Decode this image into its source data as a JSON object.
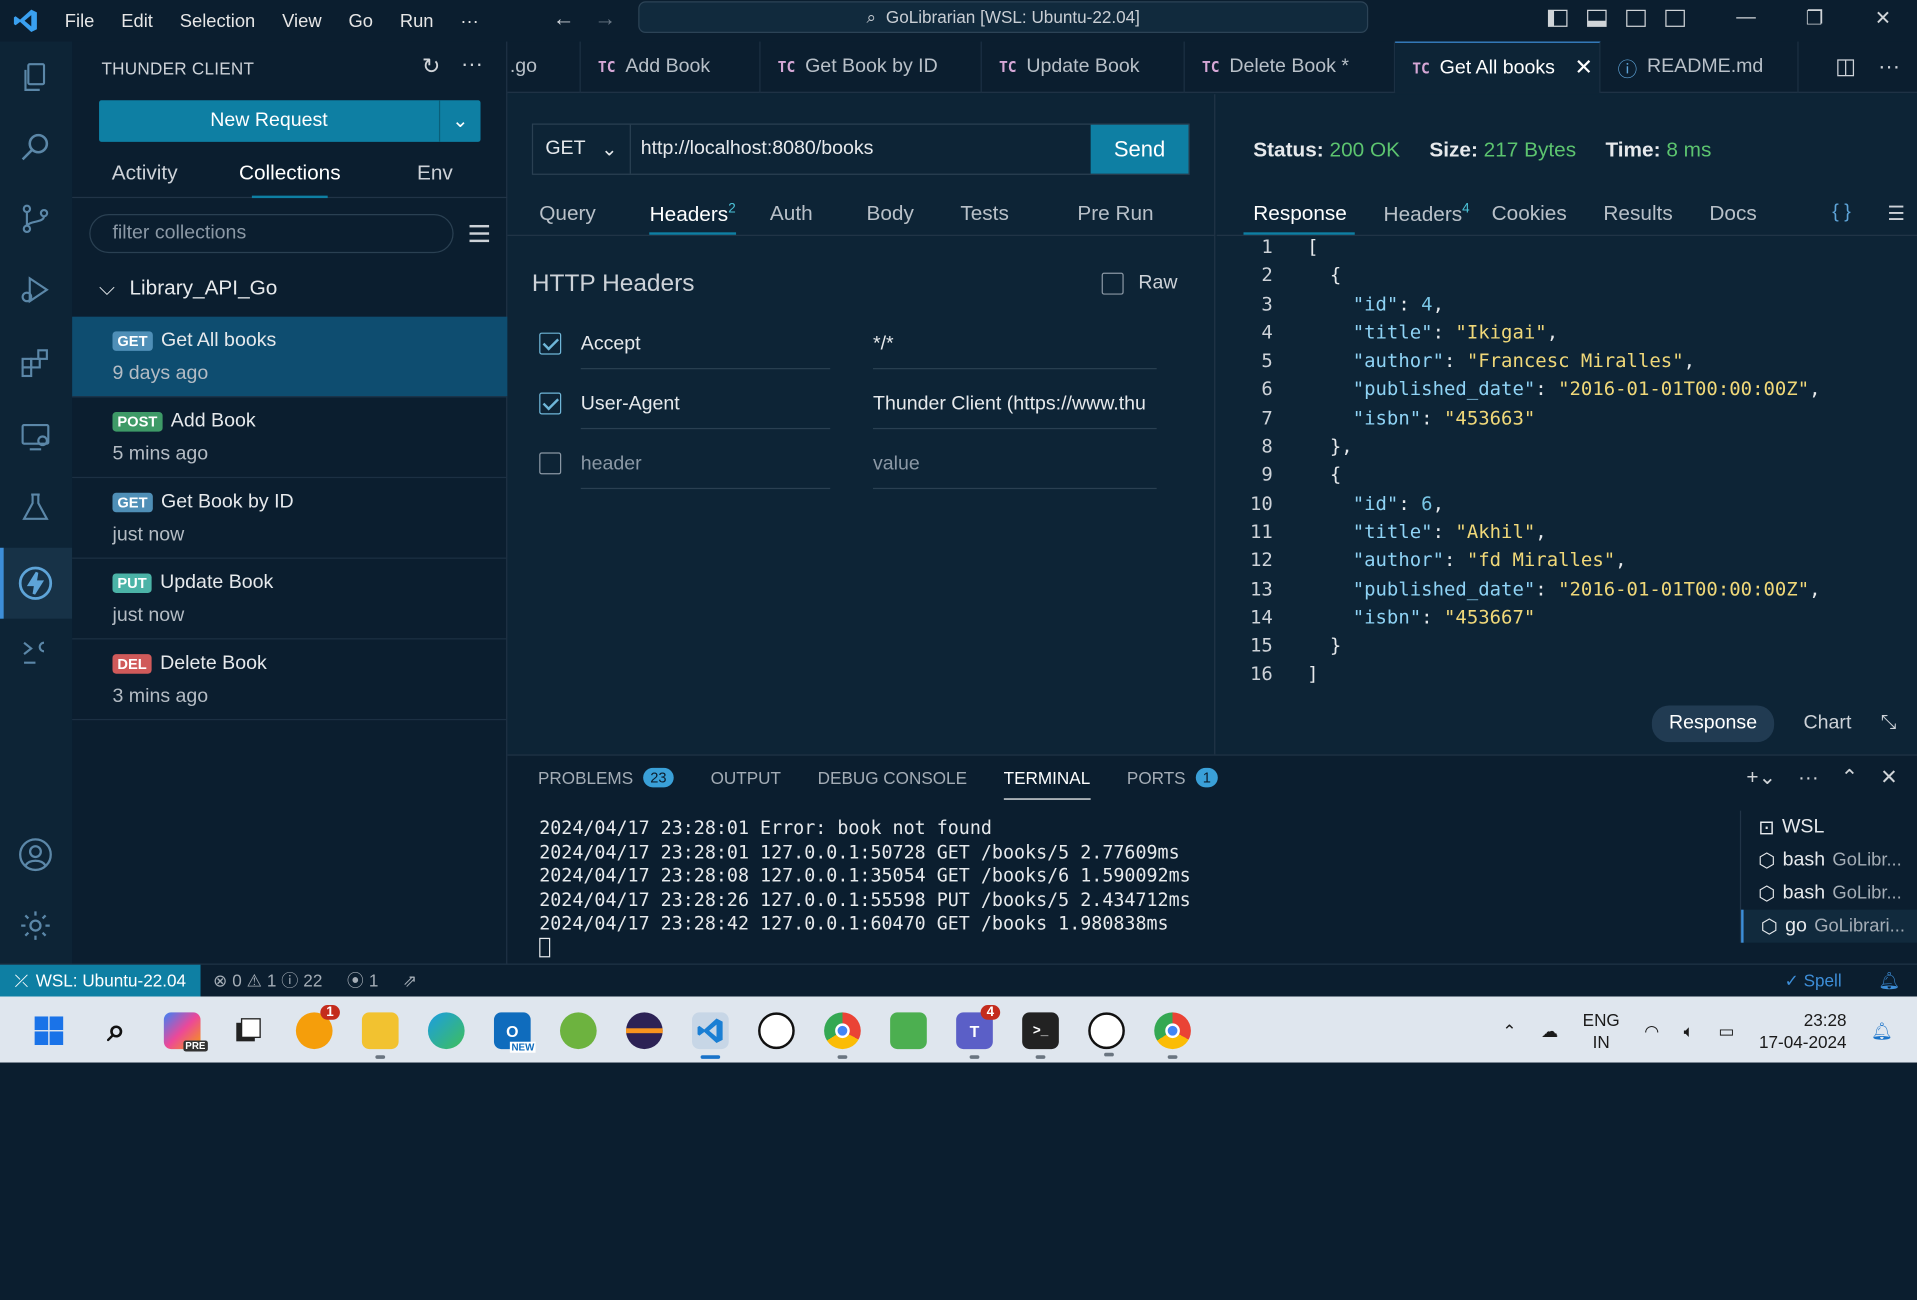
{
  "titlebar": {
    "menus": [
      "File",
      "Edit",
      "Selection",
      "View",
      "Go",
      "Run",
      "···"
    ],
    "search_text": "GoLibrarian [WSL: Ubuntu-22.04]"
  },
  "sidebar": {
    "title": "THUNDER CLIENT",
    "new_request": "New Request",
    "tabs": [
      "Activity",
      "Collections",
      "Env"
    ],
    "filter_placeholder": "filter collections",
    "collection": "Library_API_Go",
    "requests": [
      {
        "method": "GET",
        "name": "Get All books",
        "time": "9 days ago"
      },
      {
        "method": "POST",
        "name": "Add Book",
        "time": "5 mins ago"
      },
      {
        "method": "GET",
        "name": "Get Book by ID",
        "time": "just now"
      },
      {
        "method": "PUT",
        "name": "Update Book",
        "time": "just now"
      },
      {
        "method": "DEL",
        "name": "Delete Book",
        "time": "3 mins ago"
      }
    ]
  },
  "tabs": [
    {
      "prefix": "",
      "label": ".go"
    },
    {
      "prefix": "TC",
      "label": "Add Book"
    },
    {
      "prefix": "TC",
      "label": "Get Book by ID"
    },
    {
      "prefix": "TC",
      "label": "Update Book"
    },
    {
      "prefix": "TC",
      "label": "Delete Book *"
    },
    {
      "prefix": "TC",
      "label": "Get All books"
    },
    {
      "prefix": "ⓘ",
      "label": "README.md"
    }
  ],
  "request": {
    "method": "GET",
    "url": "http://localhost:8080/books",
    "send": "Send",
    "tabs": [
      "Query",
      "Headers",
      "Auth",
      "Body",
      "Tests",
      "Pre Run"
    ],
    "headers_count": "2",
    "section_title": "HTTP Headers",
    "raw_label": "Raw",
    "headers": [
      {
        "key": "Accept",
        "value": "*/*",
        "checked": true
      },
      {
        "key": "User-Agent",
        "value": "Thunder Client (https://www.thu",
        "checked": true
      },
      {
        "key": "header",
        "value": "value",
        "checked": false
      }
    ]
  },
  "response": {
    "status_label": "Status:",
    "status": "200 OK",
    "size_label": "Size:",
    "size": "217 Bytes",
    "time_label": "Time:",
    "time": "8 ms",
    "tabs": [
      "Response",
      "Headers",
      "Cookies",
      "Results",
      "Docs"
    ],
    "headers_count": "4",
    "braces": "{ }",
    "view_response": "Response",
    "view_chart": "Chart",
    "lines": [
      "[",
      "  {",
      "    \"id\": 4,",
      "    \"title\": \"Ikigai\",",
      "    \"author\": \"Francesc Miralles\",",
      "    \"published_date\": \"2016-01-01T00:00:00Z\",",
      "    \"isbn\": \"453663\"",
      "  },",
      "  {",
      "    \"id\": 6,",
      "    \"title\": \"Akhil\",",
      "    \"author\": \"fd Miralles\",",
      "    \"published_date\": \"2016-01-01T00:00:00Z\",",
      "    \"isbn\": \"453667\"",
      "  }",
      "]"
    ]
  },
  "panel": {
    "tabs": [
      "PROBLEMS",
      "OUTPUT",
      "DEBUG CONSOLE",
      "TERMINAL",
      "PORTS"
    ],
    "problems_count": "23",
    "ports_count": "1",
    "terminal_lines": [
      "2024/04/17 23:28:01 Error: book not found",
      "2024/04/17 23:28:01 127.0.0.1:50728 GET /books/5 2.77609ms",
      "2024/04/17 23:28:08 127.0.0.1:35054 GET /books/6 1.590092ms",
      "2024/04/17 23:28:26 127.0.0.1:55598 PUT /books/5 2.434712ms",
      "2024/04/17 23:28:42 127.0.0.1:60470 GET /books 1.980838ms"
    ],
    "terminals": [
      {
        "name": "WSL",
        "sub": ""
      },
      {
        "name": "bash",
        "sub": "GoLibr..."
      },
      {
        "name": "bash",
        "sub": "GoLibr..."
      },
      {
        "name": "go",
        "sub": "GoLibrari..."
      }
    ]
  },
  "statusbar": {
    "remote": "WSL: Ubuntu-22.04",
    "errors": "0",
    "warnings": "1",
    "infos": "22",
    "ports": "1",
    "spell": "Spell"
  },
  "taskbar": {
    "lang_top": "ENG",
    "lang_bottom": "IN",
    "time": "23:28",
    "date": "17-04-2024",
    "badge_widget": "1",
    "badge_teams": "4",
    "badge_outlook": "NEW",
    "badge_copilot": "PRE"
  }
}
